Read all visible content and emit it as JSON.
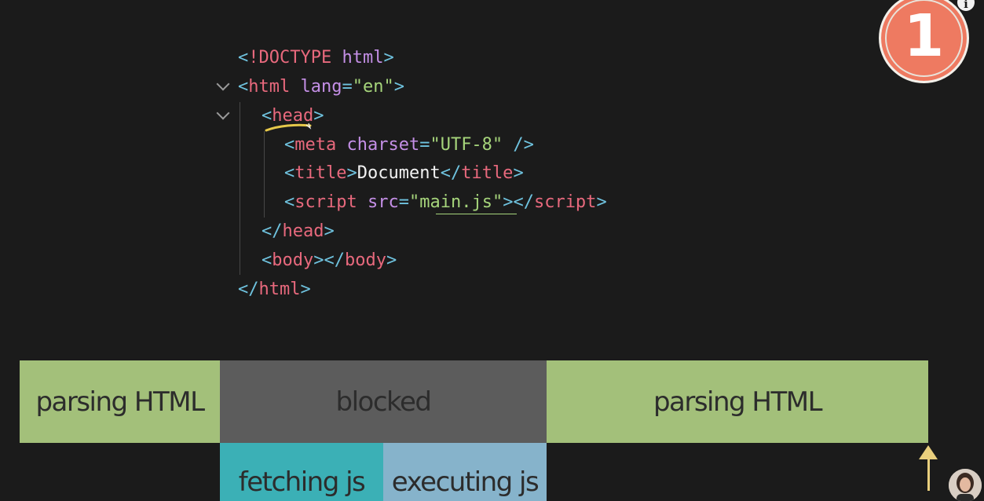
{
  "code_lines": [
    {
      "tokens": [
        {
          "t": "<",
          "c": "bracket"
        },
        {
          "t": "!DOCTYPE",
          "c": "tag"
        },
        {
          "t": " ",
          "c": "text"
        },
        {
          "t": "html",
          "c": "attr"
        },
        {
          "t": ">",
          "c": "bracket"
        }
      ]
    },
    {
      "tokens": [
        {
          "t": "<",
          "c": "bracket"
        },
        {
          "t": "html",
          "c": "tag"
        },
        {
          "t": " ",
          "c": "text"
        },
        {
          "t": "lang",
          "c": "attr"
        },
        {
          "t": "=",
          "c": "bracket"
        },
        {
          "t": "\"en\"",
          "c": "str"
        },
        {
          "t": ">",
          "c": "bracket"
        }
      ]
    },
    {
      "tokens": [
        {
          "t": "<",
          "c": "bracket"
        },
        {
          "t": "head",
          "c": "tag"
        },
        {
          "t": ">",
          "c": "bracket"
        }
      ]
    },
    {
      "tokens": [
        {
          "t": "<",
          "c": "bracket"
        },
        {
          "t": "meta",
          "c": "tag"
        },
        {
          "t": " ",
          "c": "text"
        },
        {
          "t": "charset",
          "c": "attr"
        },
        {
          "t": "=",
          "c": "bracket"
        },
        {
          "t": "\"UTF-8\"",
          "c": "str"
        },
        {
          "t": " />",
          "c": "bracket"
        }
      ]
    },
    {
      "tokens": [
        {
          "t": "<",
          "c": "bracket"
        },
        {
          "t": "title",
          "c": "tag"
        },
        {
          "t": ">",
          "c": "bracket"
        },
        {
          "t": "Document",
          "c": "text"
        },
        {
          "t": "</",
          "c": "bracket"
        },
        {
          "t": "title",
          "c": "tag"
        },
        {
          "t": ">",
          "c": "bracket"
        }
      ]
    },
    {
      "tokens": [
        {
          "t": "<",
          "c": "bracket"
        },
        {
          "t": "script",
          "c": "tag"
        },
        {
          "t": " ",
          "c": "text"
        },
        {
          "t": "src",
          "c": "attr"
        },
        {
          "t": "=",
          "c": "bracket"
        },
        {
          "t": "\"",
          "c": "str"
        },
        {
          "t": "main.js",
          "c": "str"
        },
        {
          "t": "\"",
          "c": "str"
        },
        {
          "t": "></",
          "c": "bracket"
        },
        {
          "t": "script",
          "c": "tag"
        },
        {
          "t": ">",
          "c": "bracket"
        }
      ]
    },
    {
      "tokens": [
        {
          "t": "</",
          "c": "bracket"
        },
        {
          "t": "head",
          "c": "tag"
        },
        {
          "t": ">",
          "c": "bracket"
        }
      ]
    },
    {
      "tokens": [
        {
          "t": "<",
          "c": "bracket"
        },
        {
          "t": "body",
          "c": "tag"
        },
        {
          "t": "></",
          "c": "bracket"
        },
        {
          "t": "body",
          "c": "tag"
        },
        {
          "t": ">",
          "c": "bracket"
        }
      ]
    },
    {
      "tokens": [
        {
          "t": "</",
          "c": "bracket"
        },
        {
          "t": "html",
          "c": "tag"
        },
        {
          "t": ">",
          "c": "bracket"
        }
      ]
    }
  ],
  "timeline": {
    "parsing_1": "parsing HTML",
    "blocked": "blocked",
    "parsing_2": "parsing HTML",
    "fetching": "fetching js",
    "executing": "executing js"
  },
  "badge": {
    "number": "1",
    "info_glyph": "i"
  },
  "colors": {
    "background": "#1b1b1b",
    "tag": "#e8697d",
    "bracket": "#6fc3df",
    "attribute": "#c48fe6",
    "string": "#a6d57b",
    "parsing_block": "#a3c07a",
    "blocked_block": "#5c5c5c",
    "fetching_block": "#3bb0b6",
    "executing_block": "#86b3cb",
    "badge": "#ee7a61",
    "arrow": "#e9cf7d",
    "highlight_underline": "#e6c84a"
  },
  "icons": {
    "fold": "chevron-down-icon",
    "info": "info-icon",
    "pointer": "arrow-up-icon"
  }
}
